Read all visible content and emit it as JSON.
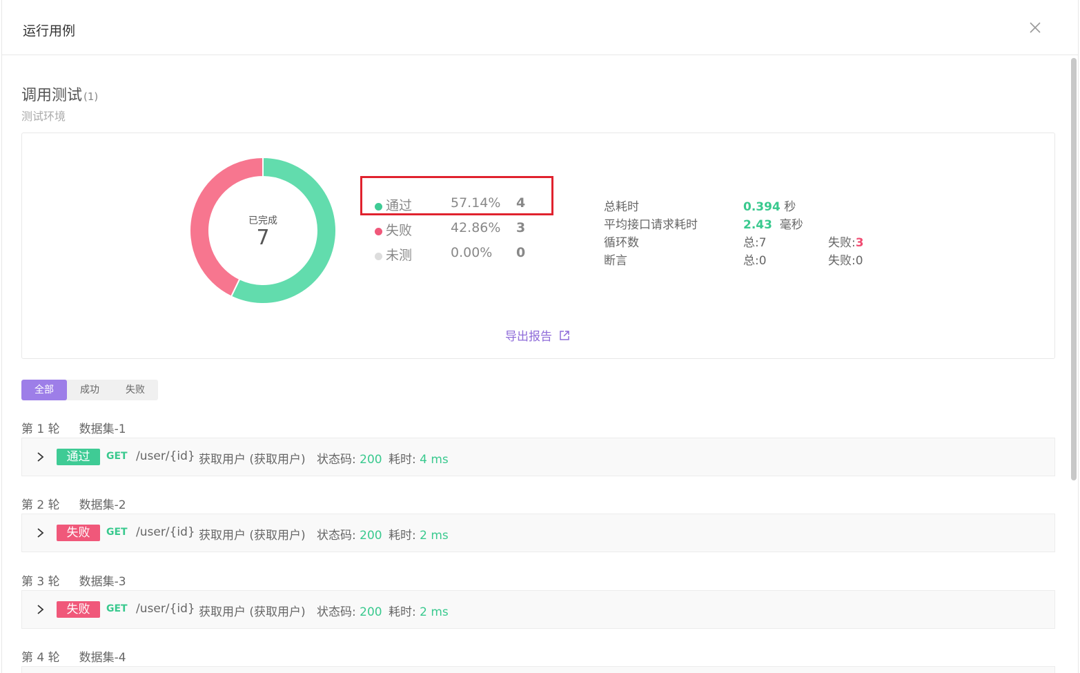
{
  "modal": {
    "title": "运行用例"
  },
  "section": {
    "title": "调用测试",
    "count": "(1)",
    "environment": "测试环境"
  },
  "summary": {
    "completed_label": "已完成",
    "completed_value": "7",
    "legend": [
      {
        "name": "通过",
        "percent": "57.14%",
        "count": "4",
        "color": "#62dcad"
      },
      {
        "name": "失败",
        "percent": "42.86%",
        "count": "3",
        "color": "#f7768f"
      },
      {
        "name": "未测",
        "percent": "0.00%",
        "count": "0",
        "color": "#dddddd"
      }
    ],
    "donut": {
      "pass_fraction": 0.5714,
      "fail_fraction": 0.4286,
      "untested_fraction": 0.0
    },
    "stats": {
      "total_time_label": "总耗时",
      "total_time_value": "0.394",
      "total_time_unit": "秒",
      "avg_time_label": "平均接口请求耗时",
      "avg_time_value": "2.43",
      "avg_time_unit": "毫秒",
      "loops_label": "循环数",
      "loops_total": "总:7",
      "loops_fail_label": "失败:",
      "loops_fail_value": "3",
      "assert_label": "断言",
      "assert_total": "总:0",
      "assert_fail": "失败:0"
    },
    "export_label": "导出报告"
  },
  "filters": [
    {
      "label": "全部",
      "active": true
    },
    {
      "label": "成功",
      "active": false
    },
    {
      "label": "失败",
      "active": false
    }
  ],
  "rounds": [
    {
      "label": "第 1 轮",
      "dataset": "数据集-1",
      "status": "通过",
      "pass": true,
      "method": "GET",
      "path": "/user/{id}",
      "name": "获取用户 (获取用户)",
      "code_label": "状态码:",
      "code": "200",
      "time_label": "耗时:",
      "time": "4 ms"
    },
    {
      "label": "第 2 轮",
      "dataset": "数据集-2",
      "status": "失败",
      "pass": false,
      "method": "GET",
      "path": "/user/{id}",
      "name": "获取用户 (获取用户)",
      "code_label": "状态码:",
      "code": "200",
      "time_label": "耗时:",
      "time": "2 ms"
    },
    {
      "label": "第 3 轮",
      "dataset": "数据集-3",
      "status": "失败",
      "pass": false,
      "method": "GET",
      "path": "/user/{id}",
      "name": "获取用户 (获取用户)",
      "code_label": "状态码:",
      "code": "200",
      "time_label": "耗时:",
      "time": "2 ms"
    },
    {
      "label": "第 4 轮",
      "dataset": "数据集-4"
    }
  ]
}
